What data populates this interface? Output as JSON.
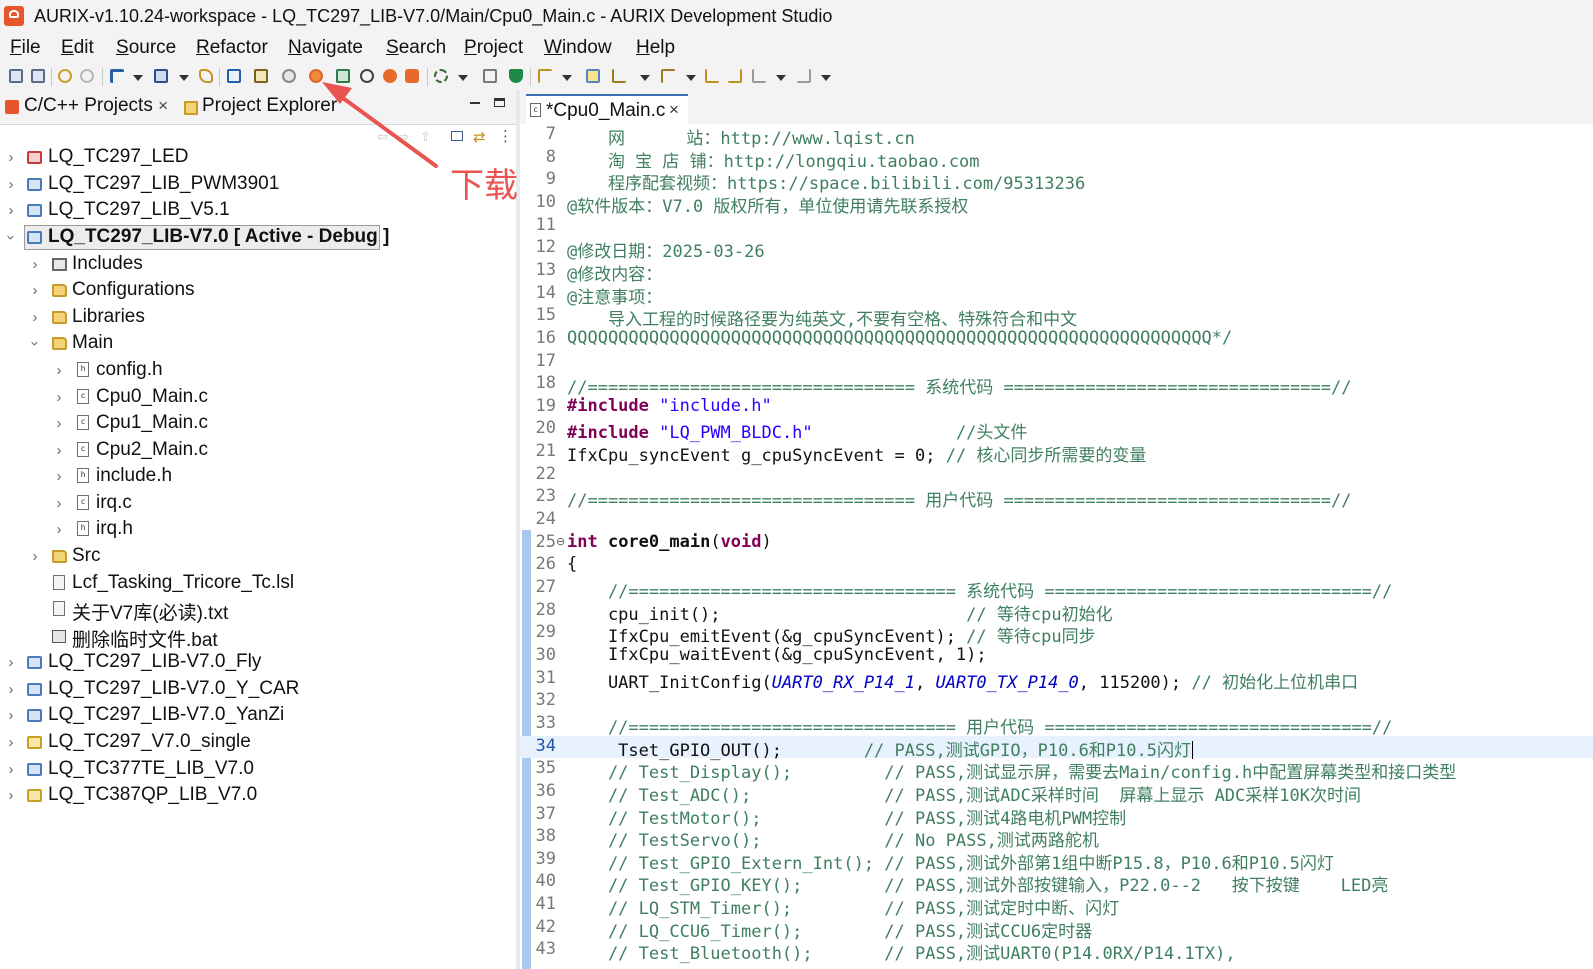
{
  "window": {
    "title": "AURIX-v1.10.24-workspace - LQ_TC297_LIB-V7.0/Main/Cpu0_Main.c - AURIX Development Studio"
  },
  "menu": [
    "File",
    "Edit",
    "Source",
    "Refactor",
    "Navigate",
    "Search",
    "Project",
    "Window",
    "Help"
  ],
  "left_panel": {
    "tabs": [
      {
        "label": "C/C++ Projects",
        "close": "×"
      },
      {
        "label": "Project Explorer"
      }
    ],
    "tree": [
      {
        "label": "LQ_TC297_LED"
      },
      {
        "label": "LQ_TC297_LIB_PWM3901"
      },
      {
        "label": "LQ_TC297_LIB_V5.1"
      },
      {
        "label": "LQ_TC297_LIB-V7.0 [ Active - Debug ]"
      },
      {
        "label": "Includes"
      },
      {
        "label": "Configurations"
      },
      {
        "label": "Libraries"
      },
      {
        "label": "Main"
      },
      {
        "label": "config.h"
      },
      {
        "label": "Cpu0_Main.c"
      },
      {
        "label": "Cpu1_Main.c"
      },
      {
        "label": "Cpu2_Main.c"
      },
      {
        "label": "include.h"
      },
      {
        "label": "irq.c"
      },
      {
        "label": "irq.h"
      },
      {
        "label": "Src"
      },
      {
        "label": "Lcf_Tasking_Tricore_Tc.lsl"
      },
      {
        "label": "关于V7库(必读).txt"
      },
      {
        "label": "删除临时文件.bat"
      },
      {
        "label": "LQ_TC297_LIB-V7.0_Fly"
      },
      {
        "label": "LQ_TC297_LIB-V7.0_Y_CAR"
      },
      {
        "label": "LQ_TC297_LIB-V7.0_YanZi"
      },
      {
        "label": "LQ_TC297_V7.0_single"
      },
      {
        "label": "LQ_TC377TE_LIB_V7.0"
      },
      {
        "label": "LQ_TC387QP_LIB_V7.0"
      }
    ]
  },
  "annotation": {
    "text": "下载"
  },
  "editor": {
    "tab": {
      "label": "*Cpu0_Main.c",
      "close": "×"
    },
    "lines": [
      {
        "n": "7",
        "segs": [
          {
            "t": "    网      站：",
            "c": "comment"
          },
          {
            "t": "http://www.lqist.cn",
            "c": "comment"
          }
        ]
      },
      {
        "n": "8",
        "segs": [
          {
            "t": "    淘 宝 店 铺：",
            "c": "comment"
          },
          {
            "t": "http://longqiu.taobao.com",
            "c": "comment"
          }
        ]
      },
      {
        "n": "9",
        "segs": [
          {
            "t": "    程序配套视频：",
            "c": "comment"
          },
          {
            "t": "https://space.bilibili.com/95313236",
            "c": "comment"
          }
        ]
      },
      {
        "n": "10",
        "segs": [
          {
            "t": "@软件版本：V7.0 版权所有，单位使用请先联系授权",
            "c": "comment"
          }
        ]
      },
      {
        "n": "11",
        "segs": [
          {
            "t": "",
            "c": "plain"
          }
        ]
      },
      {
        "n": "12",
        "segs": [
          {
            "t": "@修改日期：2025-03-26",
            "c": "comment"
          }
        ]
      },
      {
        "n": "13",
        "segs": [
          {
            "t": "@修改内容：",
            "c": "comment"
          }
        ]
      },
      {
        "n": "14",
        "segs": [
          {
            "t": "@注意事项：",
            "c": "comment"
          }
        ]
      },
      {
        "n": "15",
        "segs": [
          {
            "t": "    导入工程的时候路径要为纯英文,不要有空格、特殊符合和中文",
            "c": "comment"
          }
        ]
      },
      {
        "n": "16",
        "segs": [
          {
            "t": "QQQQQQQQQQQQQQQQQQQQQQQQQQQQQQQQQQQQQQQQQQQQQQQQQQQQQQQQQQQQQQQ*/",
            "c": "comment"
          }
        ]
      },
      {
        "n": "17",
        "segs": [
          {
            "t": "",
            "c": "plain"
          }
        ]
      },
      {
        "n": "18",
        "segs": [
          {
            "t": "//================================ 系统代码 ================================//",
            "c": "comment"
          }
        ]
      },
      {
        "n": "19",
        "segs": [
          {
            "t": "#include ",
            "c": "kw"
          },
          {
            "t": "\"include.h\"",
            "c": "str"
          }
        ]
      },
      {
        "n": "20",
        "segs": [
          {
            "t": "#include ",
            "c": "kw"
          },
          {
            "t": "\"LQ_PWM_BLDC.h\"",
            "c": "str"
          },
          {
            "t": "              //头文件",
            "c": "comment"
          }
        ]
      },
      {
        "n": "21",
        "segs": [
          {
            "t": "IfxCpu_syncEvent g_cpuSyncEvent = 0; ",
            "c": "plain"
          },
          {
            "t": "// 核心同步所需要的变量",
            "c": "comment"
          }
        ]
      },
      {
        "n": "22",
        "segs": [
          {
            "t": "",
            "c": "plain"
          }
        ]
      },
      {
        "n": "23",
        "segs": [
          {
            "t": "//================================ 用户代码 ================================//",
            "c": "comment"
          }
        ]
      },
      {
        "n": "24",
        "segs": [
          {
            "t": "",
            "c": "plain"
          }
        ]
      },
      {
        "n": "25",
        "fold": "⊖",
        "segs": [
          {
            "t": "int ",
            "c": "kw"
          },
          {
            "t": "core0_main",
            "c": "bold"
          },
          {
            "t": "(",
            "c": "plain"
          },
          {
            "t": "void",
            "c": "kw"
          },
          {
            "t": ")",
            "c": "plain"
          }
        ]
      },
      {
        "n": "26",
        "segs": [
          {
            "t": "{",
            "c": "plain"
          }
        ]
      },
      {
        "n": "27",
        "segs": [
          {
            "t": "    //================================ 系统代码 ================================//",
            "c": "comment"
          }
        ]
      },
      {
        "n": "28",
        "segs": [
          {
            "t": "    cpu_init();                        ",
            "c": "plain"
          },
          {
            "t": "// 等待cpu初始化",
            "c": "comment"
          }
        ]
      },
      {
        "n": "29",
        "segs": [
          {
            "t": "    IfxCpu_emitEvent(&g_cpuSyncEvent); ",
            "c": "plain"
          },
          {
            "t": "// 等待cpu同步",
            "c": "comment"
          }
        ]
      },
      {
        "n": "30",
        "segs": [
          {
            "t": "    IfxCpu_waitEvent(&g_cpuSyncEvent, 1);",
            "c": "plain"
          }
        ]
      },
      {
        "n": "31",
        "segs": [
          {
            "t": "    UART_InitConfig(",
            "c": "plain"
          },
          {
            "t": "UART0_RX_P14_1",
            "c": "macro"
          },
          {
            "t": ", ",
            "c": "plain"
          },
          {
            "t": "UART0_TX_P14_0",
            "c": "macro"
          },
          {
            "t": ", 115200); ",
            "c": "plain"
          },
          {
            "t": "// 初始化上位机串口",
            "c": "comment"
          }
        ]
      },
      {
        "n": "32",
        "segs": [
          {
            "t": "",
            "c": "plain"
          }
        ]
      },
      {
        "n": "33",
        "segs": [
          {
            "t": "    //================================ 用户代码 ================================//",
            "c": "comment"
          }
        ]
      },
      {
        "n": "34",
        "current": true,
        "segs": [
          {
            "t": "     Tset_GPIO_OUT();        ",
            "c": "plain"
          },
          {
            "t": "// PASS,测试GPIO，P10.6和P10.5闪灯",
            "c": "comment"
          }
        ]
      },
      {
        "n": "35",
        "segs": [
          {
            "t": "    // Test_Display();         // PASS,测试显示屏，需要去Main/config.h中配置屏幕类型和接口类型",
            "c": "comment"
          }
        ]
      },
      {
        "n": "36",
        "segs": [
          {
            "t": "    // Test_ADC();             // PASS,测试ADC采样时间  屏幕上显示 ADC采样10K次时间",
            "c": "comment"
          }
        ]
      },
      {
        "n": "37",
        "segs": [
          {
            "t": "    // TestMotor();            // PASS,测试4路电机PWM控制",
            "c": "comment"
          }
        ]
      },
      {
        "n": "38",
        "segs": [
          {
            "t": "    // TestServo();            // No PASS,测试两路舵机",
            "c": "comment"
          }
        ]
      },
      {
        "n": "39",
        "segs": [
          {
            "t": "    // Test_GPIO_Extern_Int(); // PASS,测试外部第1组中断P15.8，P10.6和P10.5闪灯",
            "c": "comment"
          }
        ]
      },
      {
        "n": "40",
        "segs": [
          {
            "t": "    // Test_GPIO_KEY();        // PASS,测试外部按键输入，P22.0--2   按下按键    LED亮",
            "c": "comment"
          }
        ]
      },
      {
        "n": "41",
        "segs": [
          {
            "t": "    // LQ_STM_Timer();         // PASS,测试定时中断、闪灯",
            "c": "comment"
          }
        ]
      },
      {
        "n": "42",
        "segs": [
          {
            "t": "    // LQ_CCU6_Timer();        // PASS,测试CCU6定时器",
            "c": "comment"
          }
        ]
      },
      {
        "n": "43",
        "segs": [
          {
            "t": "    // Test_Bluetooth();       // PASS,测试UART0(P14.0RX/P14.1TX),",
            "c": "comment"
          }
        ]
      }
    ]
  }
}
